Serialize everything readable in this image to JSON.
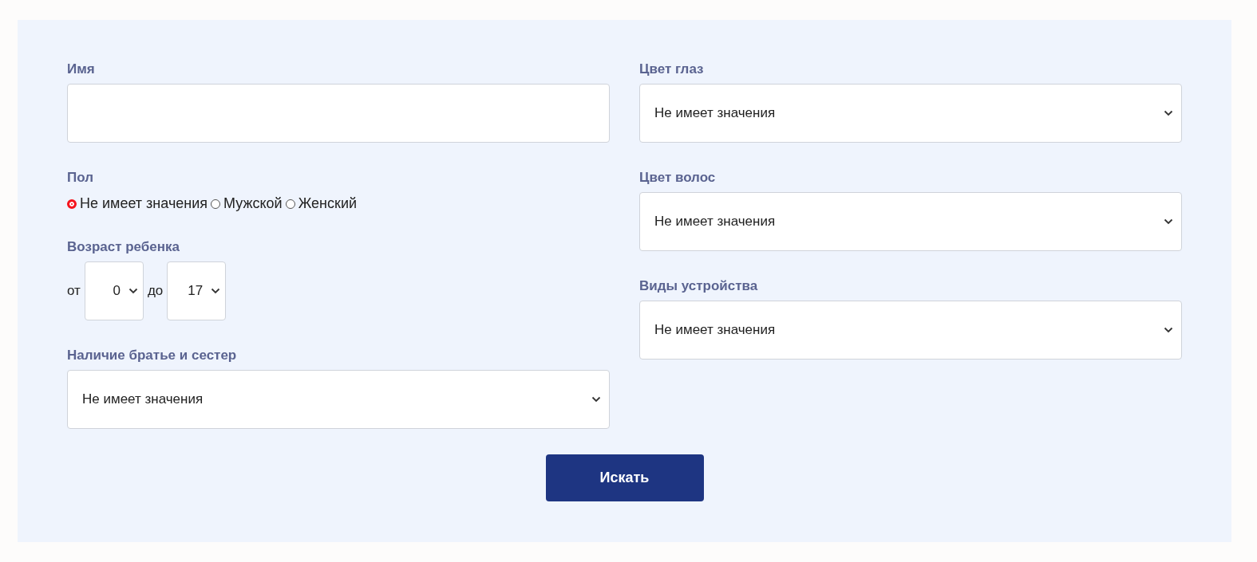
{
  "columns": [
    [
      {
        "kind": "text",
        "label": "Имя"
      },
      {
        "kind": "radio",
        "label": "Пол",
        "options": [
          {
            "label": "Не имеет значения",
            "selected": true
          },
          {
            "label": "Мужской",
            "selected": false
          },
          {
            "label": "Женский",
            "selected": false
          }
        ]
      },
      {
        "kind": "range",
        "label": "Возраст ребенка",
        "from_label": "от",
        "from": "0",
        "to_label": "до",
        "to": "17"
      },
      {
        "kind": "select",
        "label": "Наличие братье и сестер",
        "value": "Не имеет значения"
      }
    ],
    [
      {
        "kind": "select",
        "label": "Цвет глаз",
        "value": "Не имеет значения"
      },
      {
        "kind": "select",
        "label": "Цвет волос",
        "value": "Не имеет значения"
      },
      {
        "kind": "select",
        "label": "Виды устройства",
        "value": "Не имеет значения"
      }
    ]
  ],
  "submit": "Искать"
}
